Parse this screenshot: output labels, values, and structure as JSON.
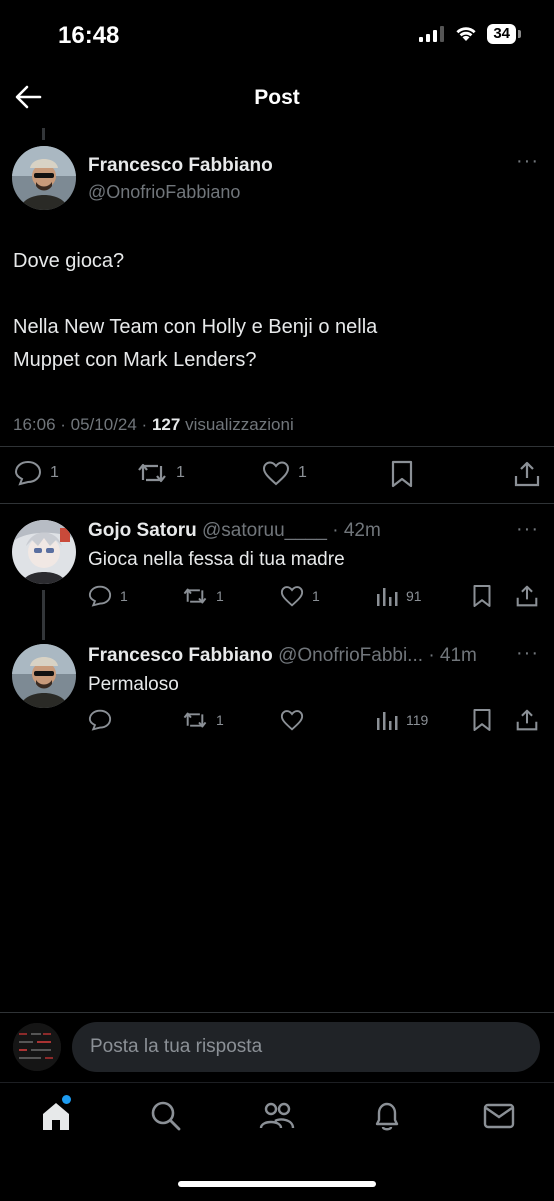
{
  "status": {
    "time": "16:48",
    "battery": "34"
  },
  "header": {
    "title": "Post"
  },
  "main_post": {
    "author": "Francesco Fabbiano",
    "handle": "@OnofrioFabbiano",
    "text_line1": "Dove gioca?",
    "text_line2": "Nella New Team con Holly e Benji o nella",
    "text_line3": "Muppet con Mark Lenders?",
    "meta_time": "16:06 · 05/10/24 ·",
    "views_count": "127",
    "views_label": "visualizzazioni",
    "replies": "1",
    "reposts": "1",
    "likes": "1"
  },
  "replies": [
    {
      "author": "Gojo Satoru",
      "handle": "@satoruu____",
      "time": "· 42m",
      "text": "Gioca nella fessa di tua madre",
      "replies": "1",
      "reposts": "1",
      "likes": "1",
      "views": "91"
    },
    {
      "author": "Francesco Fabbiano",
      "handle": "@OnofrioFabbi...",
      "time": "· 41m",
      "text": "Permaloso",
      "replies": "",
      "reposts": "1",
      "likes": "",
      "views": "119"
    }
  ],
  "composer": {
    "placeholder": "Posta la tua risposta"
  },
  "tabbar": {
    "icons": [
      "home-icon",
      "search-icon",
      "communities-icon",
      "notifications-icon",
      "messages-icon"
    ],
    "notification_dot_color": "#1d9bf0"
  },
  "colors": {
    "background": "#000000",
    "text": "#e7e9ea",
    "muted": "#71767b",
    "accent": "#1d9bf0"
  }
}
